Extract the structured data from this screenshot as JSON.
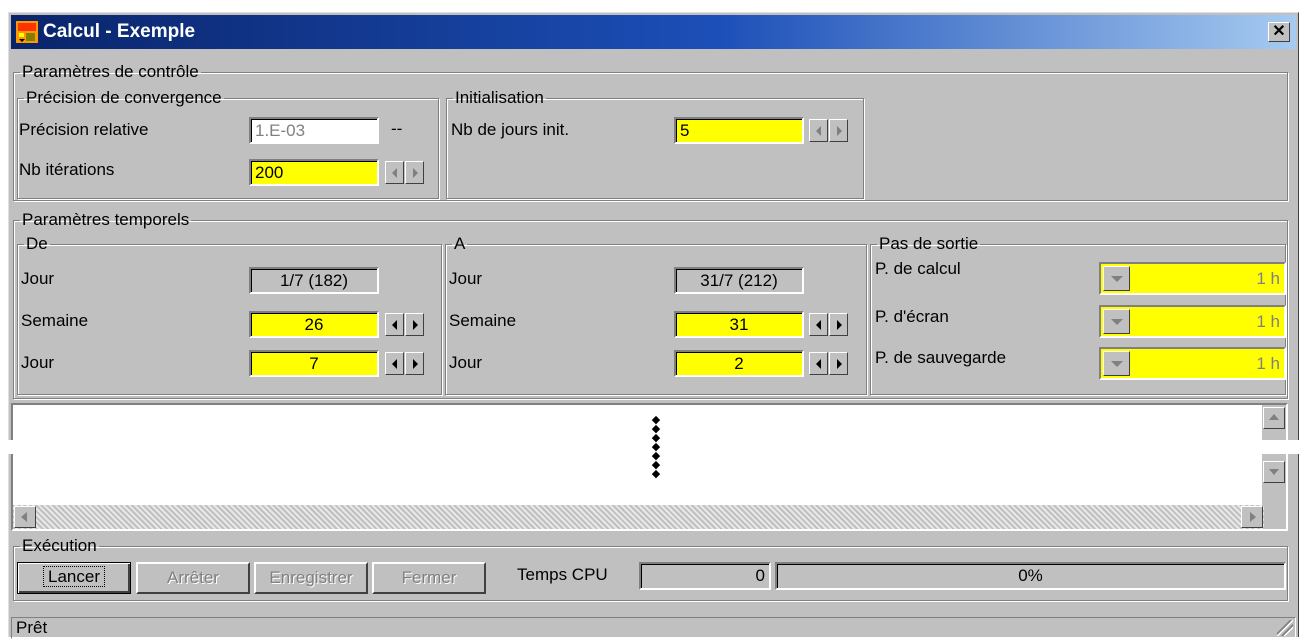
{
  "window": {
    "title": "Calcul - Exemple",
    "close_glyph": "✕"
  },
  "controle": {
    "title": "Paramètres de contrôle",
    "convergence": {
      "title": "Précision de convergence",
      "precision_label": "Précision relative",
      "precision_value": "1.E-03",
      "precision_unit": "--",
      "iterations_label": "Nb itérations",
      "iterations_value": "200"
    },
    "init": {
      "title": "Initialisation",
      "label": "Nb de jours init.",
      "value": "5"
    }
  },
  "temporels": {
    "title": "Paramètres temporels",
    "de": {
      "title": "De",
      "jour_label": "Jour",
      "jour_value": "1/7 (182)",
      "semaine_label": "Semaine",
      "semaine_value": "26",
      "jour2_label": "Jour",
      "jour2_value": "7"
    },
    "a": {
      "title": "A",
      "jour_label": "Jour",
      "jour_value": "31/7 (212)",
      "semaine_label": "Semaine",
      "semaine_value": "31",
      "jour2_label": "Jour",
      "jour2_value": "2"
    },
    "sortie": {
      "title": "Pas de sortie",
      "items": [
        {
          "label": "P. de calcul",
          "value": "1 h"
        },
        {
          "label": "P. d'écran",
          "value": "1 h"
        },
        {
          "label": "P. de sauvegarde",
          "value": "1 h"
        }
      ]
    }
  },
  "log": {
    "ellipsis": "◆\n◆\n◆\n◆\n◆\n◆\n◆"
  },
  "execution": {
    "title": "Exécution",
    "buttons": {
      "lancer": "Lancer",
      "arreter": "Arrêter",
      "enregistrer": "Enregistrer",
      "fermer": "Fermer"
    },
    "cpu_label": "Temps CPU",
    "cpu_value": "0",
    "progress_text": "0%",
    "progress": 0
  },
  "status": "Prêt",
  "colors": {
    "title_start": "#0a246a",
    "title_end": "#a6caf0",
    "field_highlight": "#ffff00",
    "face": "#c0c0c0"
  }
}
